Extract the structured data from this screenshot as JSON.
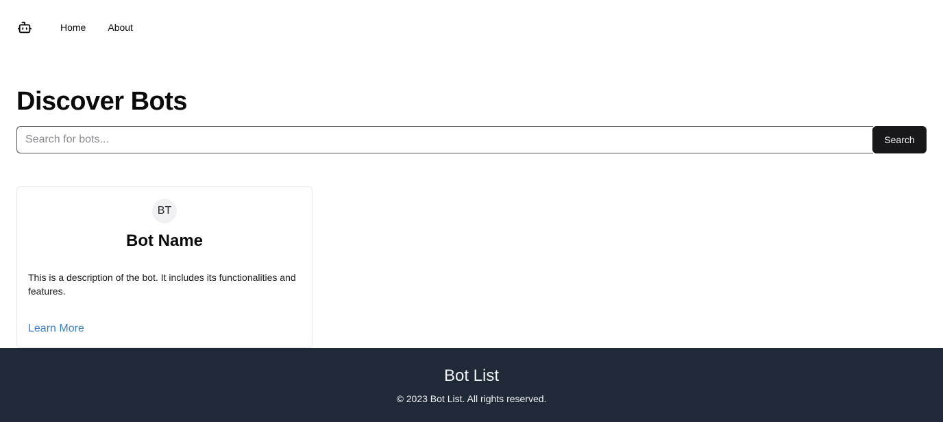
{
  "header": {
    "logo_icon": "bot-icon",
    "nav": [
      {
        "label": "Home"
      },
      {
        "label": "About"
      }
    ]
  },
  "main": {
    "title": "Discover Bots",
    "search": {
      "placeholder": "Search for bots...",
      "value": "",
      "button_label": "Search"
    },
    "cards": [
      {
        "avatar_initials": "BT",
        "name": "Bot Name",
        "description": "This is a description of the bot. It includes its functionalities and features.",
        "link_label": "Learn More"
      }
    ]
  },
  "footer": {
    "title": "Bot List",
    "copyright": "© 2023 Bot List. All rights reserved."
  },
  "colors": {
    "footer_bg": "#1f2937",
    "button_bg": "#18181b",
    "link": "#3b82c6"
  }
}
